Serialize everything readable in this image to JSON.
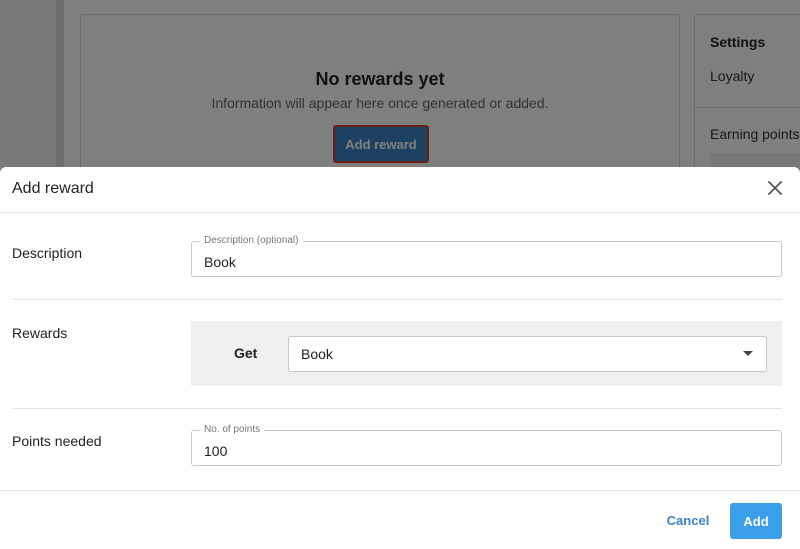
{
  "background": {
    "empty_state": {
      "title": "No rewards yet",
      "subtitle": "Information will appear here once generated or added.",
      "add_button_label": "Add reward"
    },
    "settings_panel": {
      "title": "Settings",
      "loyalty_label": "Loyalty",
      "earning_points_label": "Earning points"
    }
  },
  "modal": {
    "title": "Add reward",
    "close_icon": "close-icon",
    "description": {
      "row_label": "Description",
      "field_label": "Description (optional)",
      "value": "Book"
    },
    "rewards": {
      "row_label": "Rewards",
      "get_label": "Get",
      "selected_value": "Book"
    },
    "points": {
      "row_label": "Points needed",
      "field_label": "No. of points",
      "value": "100"
    },
    "footer": {
      "cancel_label": "Cancel",
      "add_label": "Add"
    }
  },
  "colors": {
    "accent": "#3b9ee8",
    "link": "#3b82c6",
    "highlight_border": "#d5432a"
  }
}
